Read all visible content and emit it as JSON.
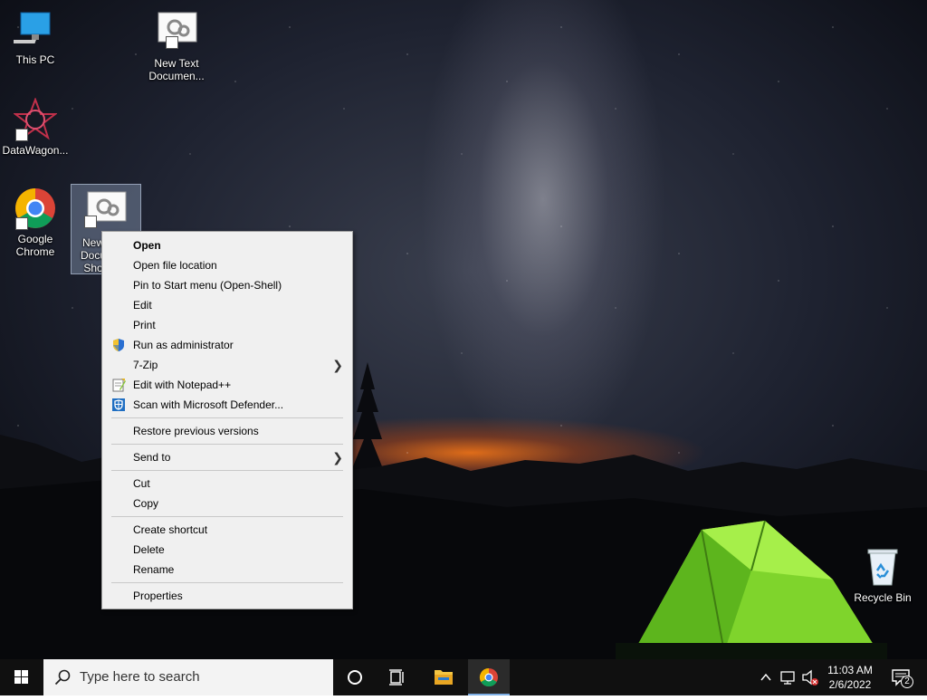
{
  "desktop": {
    "icons": [
      {
        "label": "This PC"
      },
      {
        "label": "New Text Documen..."
      },
      {
        "label": "DataWagon..."
      },
      {
        "label": "Google Chrome"
      },
      {
        "label": "New Text Document Shortcut",
        "label_visible": "New Docu Sho"
      },
      {
        "label": "Recycle Bin"
      }
    ]
  },
  "context_menu": {
    "items": [
      {
        "label": "Open"
      },
      {
        "label": "Open file location"
      },
      {
        "label": "Pin to Start menu (Open-Shell)"
      },
      {
        "label": "Edit"
      },
      {
        "label": "Print"
      },
      {
        "label": "Run as administrator",
        "icon": "shield-icon"
      },
      {
        "label": "7-Zip"
      },
      {
        "label": "Edit with Notepad++",
        "icon": "notepadpp-icon"
      },
      {
        "label": "Scan with Microsoft Defender...",
        "icon": "defender-icon"
      },
      {
        "label": "Restore previous versions"
      },
      {
        "label": "Send to"
      },
      {
        "label": "Cut"
      },
      {
        "label": "Copy"
      },
      {
        "label": "Create shortcut"
      },
      {
        "label": "Delete"
      },
      {
        "label": "Rename"
      },
      {
        "label": "Properties"
      }
    ]
  },
  "taskbar": {
    "search_placeholder": "Type here to search",
    "time": "11:03 AM",
    "date": "2/6/2022",
    "notification_count": "2"
  },
  "colors": {
    "taskbar": "#101010",
    "menu_bg": "#f0f0f0",
    "active_indicator": "#7fb0e6"
  }
}
